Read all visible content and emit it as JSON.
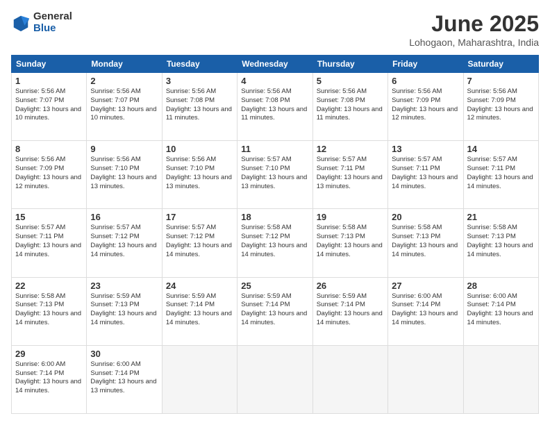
{
  "logo": {
    "general": "General",
    "blue": "Blue"
  },
  "title": "June 2025",
  "location": "Lohogaon, Maharashtra, India",
  "days_of_week": [
    "Sunday",
    "Monday",
    "Tuesday",
    "Wednesday",
    "Thursday",
    "Friday",
    "Saturday"
  ],
  "weeks": [
    [
      {
        "day": 1,
        "sunrise": "5:56 AM",
        "sunset": "7:07 PM",
        "daylight": "13 hours and 10 minutes."
      },
      {
        "day": 2,
        "sunrise": "5:56 AM",
        "sunset": "7:07 PM",
        "daylight": "13 hours and 10 minutes."
      },
      {
        "day": 3,
        "sunrise": "5:56 AM",
        "sunset": "7:08 PM",
        "daylight": "13 hours and 11 minutes."
      },
      {
        "day": 4,
        "sunrise": "5:56 AM",
        "sunset": "7:08 PM",
        "daylight": "13 hours and 11 minutes."
      },
      {
        "day": 5,
        "sunrise": "5:56 AM",
        "sunset": "7:08 PM",
        "daylight": "13 hours and 11 minutes."
      },
      {
        "day": 6,
        "sunrise": "5:56 AM",
        "sunset": "7:09 PM",
        "daylight": "13 hours and 12 minutes."
      },
      {
        "day": 7,
        "sunrise": "5:56 AM",
        "sunset": "7:09 PM",
        "daylight": "13 hours and 12 minutes."
      }
    ],
    [
      {
        "day": 8,
        "sunrise": "5:56 AM",
        "sunset": "7:09 PM",
        "daylight": "13 hours and 12 minutes."
      },
      {
        "day": 9,
        "sunrise": "5:56 AM",
        "sunset": "7:10 PM",
        "daylight": "13 hours and 13 minutes."
      },
      {
        "day": 10,
        "sunrise": "5:56 AM",
        "sunset": "7:10 PM",
        "daylight": "13 hours and 13 minutes."
      },
      {
        "day": 11,
        "sunrise": "5:57 AM",
        "sunset": "7:10 PM",
        "daylight": "13 hours and 13 minutes."
      },
      {
        "day": 12,
        "sunrise": "5:57 AM",
        "sunset": "7:11 PM",
        "daylight": "13 hours and 13 minutes."
      },
      {
        "day": 13,
        "sunrise": "5:57 AM",
        "sunset": "7:11 PM",
        "daylight": "13 hours and 14 minutes."
      },
      {
        "day": 14,
        "sunrise": "5:57 AM",
        "sunset": "7:11 PM",
        "daylight": "13 hours and 14 minutes."
      }
    ],
    [
      {
        "day": 15,
        "sunrise": "5:57 AM",
        "sunset": "7:11 PM",
        "daylight": "13 hours and 14 minutes."
      },
      {
        "day": 16,
        "sunrise": "5:57 AM",
        "sunset": "7:12 PM",
        "daylight": "13 hours and 14 minutes."
      },
      {
        "day": 17,
        "sunrise": "5:57 AM",
        "sunset": "7:12 PM",
        "daylight": "13 hours and 14 minutes."
      },
      {
        "day": 18,
        "sunrise": "5:58 AM",
        "sunset": "7:12 PM",
        "daylight": "13 hours and 14 minutes."
      },
      {
        "day": 19,
        "sunrise": "5:58 AM",
        "sunset": "7:13 PM",
        "daylight": "13 hours and 14 minutes."
      },
      {
        "day": 20,
        "sunrise": "5:58 AM",
        "sunset": "7:13 PM",
        "daylight": "13 hours and 14 minutes."
      },
      {
        "day": 21,
        "sunrise": "5:58 AM",
        "sunset": "7:13 PM",
        "daylight": "13 hours and 14 minutes."
      }
    ],
    [
      {
        "day": 22,
        "sunrise": "5:58 AM",
        "sunset": "7:13 PM",
        "daylight": "13 hours and 14 minutes."
      },
      {
        "day": 23,
        "sunrise": "5:59 AM",
        "sunset": "7:13 PM",
        "daylight": "13 hours and 14 minutes."
      },
      {
        "day": 24,
        "sunrise": "5:59 AM",
        "sunset": "7:14 PM",
        "daylight": "13 hours and 14 minutes."
      },
      {
        "day": 25,
        "sunrise": "5:59 AM",
        "sunset": "7:14 PM",
        "daylight": "13 hours and 14 minutes."
      },
      {
        "day": 26,
        "sunrise": "5:59 AM",
        "sunset": "7:14 PM",
        "daylight": "13 hours and 14 minutes."
      },
      {
        "day": 27,
        "sunrise": "6:00 AM",
        "sunset": "7:14 PM",
        "daylight": "13 hours and 14 minutes."
      },
      {
        "day": 28,
        "sunrise": "6:00 AM",
        "sunset": "7:14 PM",
        "daylight": "13 hours and 14 minutes."
      }
    ],
    [
      {
        "day": 29,
        "sunrise": "6:00 AM",
        "sunset": "7:14 PM",
        "daylight": "13 hours and 14 minutes."
      },
      {
        "day": 30,
        "sunrise": "6:00 AM",
        "sunset": "7:14 PM",
        "daylight": "13 hours and 13 minutes."
      },
      null,
      null,
      null,
      null,
      null
    ]
  ]
}
